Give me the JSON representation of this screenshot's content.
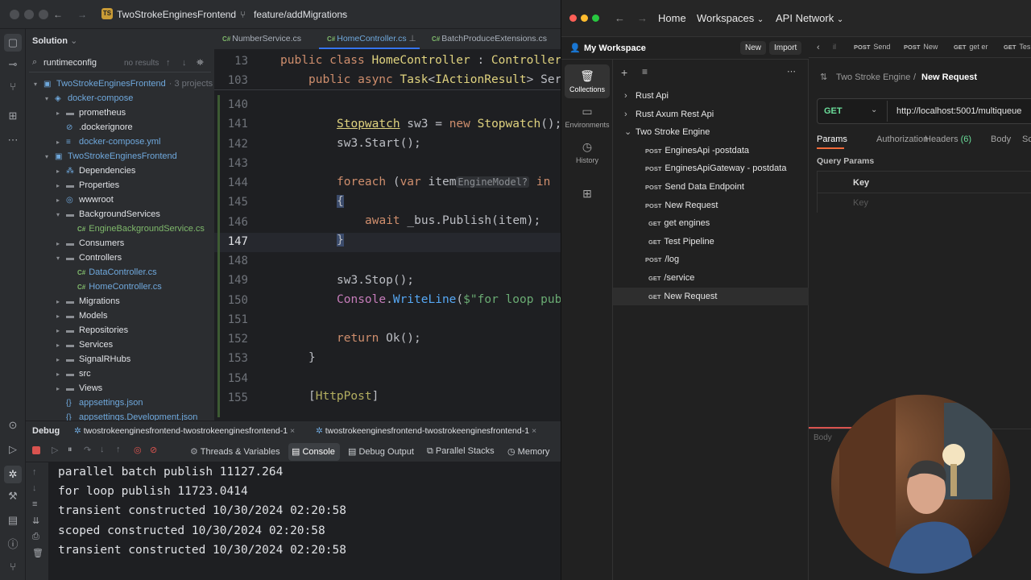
{
  "ide": {
    "project_name": "TwoStrokeEnginesFrontend",
    "project_badge": "TS",
    "branch": "feature/addMigrations",
    "solution_label": "Solution",
    "search_value": "runtimeconfig",
    "search_results": "no results",
    "tree": [
      {
        "label": "TwoStrokeEnginesFrontend",
        "extra": "· 3 projects",
        "depth": 0,
        "arrow": "▾",
        "icon": "solution-icon",
        "color": "blue"
      },
      {
        "label": "docker-compose",
        "depth": 1,
        "arrow": "▾",
        "icon": "docker-icon",
        "color": "blue"
      },
      {
        "label": "prometheus",
        "depth": 2,
        "arrow": "▸",
        "icon": "folder-icon"
      },
      {
        "label": ".dockerignore",
        "depth": 2,
        "arrow": "",
        "icon": "ignore-icon"
      },
      {
        "label": "docker-compose.yml",
        "depth": 2,
        "arrow": "▸",
        "icon": "yml-icon",
        "color": "blue"
      },
      {
        "label": "TwoStrokeEnginesFrontend",
        "depth": 1,
        "arrow": "▾",
        "icon": "project-icon",
        "color": "blue"
      },
      {
        "label": "Dependencies",
        "depth": 2,
        "arrow": "▸",
        "icon": "dependencies-icon"
      },
      {
        "label": "Properties",
        "depth": 2,
        "arrow": "▸",
        "icon": "folder-icon"
      },
      {
        "label": "wwwroot",
        "depth": 2,
        "arrow": "▸",
        "icon": "globe-folder-icon"
      },
      {
        "label": "BackgroundServices",
        "depth": 2,
        "arrow": "▾",
        "icon": "folder-icon"
      },
      {
        "label": "EngineBackgroundService.cs",
        "depth": 3,
        "arrow": "",
        "icon": "csharp-icon",
        "color": "green"
      },
      {
        "label": "Consumers",
        "depth": 2,
        "arrow": "▸",
        "icon": "folder-icon"
      },
      {
        "label": "Controllers",
        "depth": 2,
        "arrow": "▾",
        "icon": "folder-icon"
      },
      {
        "label": "DataController.cs",
        "depth": 3,
        "arrow": "",
        "icon": "csharp-icon",
        "color": "blue"
      },
      {
        "label": "HomeController.cs",
        "depth": 3,
        "arrow": "",
        "icon": "csharp-icon",
        "color": "blue"
      },
      {
        "label": "Migrations",
        "depth": 2,
        "arrow": "▸",
        "icon": "folder-icon"
      },
      {
        "label": "Models",
        "depth": 2,
        "arrow": "▸",
        "icon": "folder-icon"
      },
      {
        "label": "Repositories",
        "depth": 2,
        "arrow": "▸",
        "icon": "folder-icon"
      },
      {
        "label": "Services",
        "depth": 2,
        "arrow": "▸",
        "icon": "folder-icon"
      },
      {
        "label": "SignalRHubs",
        "depth": 2,
        "arrow": "▸",
        "icon": "folder-icon"
      },
      {
        "label": "src",
        "depth": 2,
        "arrow": "▸",
        "icon": "folder-icon"
      },
      {
        "label": "Views",
        "depth": 2,
        "arrow": "▸",
        "icon": "folder-icon"
      },
      {
        "label": "appsettings.json",
        "depth": 2,
        "arrow": "",
        "icon": "json-icon",
        "color": "blue"
      },
      {
        "label": "appsettings.Development.json",
        "depth": 2,
        "arrow": "",
        "icon": "json-icon",
        "color": "blue"
      }
    ],
    "tabs": [
      {
        "label": "NumberService.cs",
        "active": false
      },
      {
        "label": "HomeController.cs",
        "active": true
      },
      {
        "label": "BatchProduceExtensions.cs",
        "active": false
      }
    ],
    "csharp_tag": "C#",
    "sticky_lines": [
      {
        "num": "13"
      },
      {
        "num": "103"
      }
    ],
    "lines": [
      "140",
      "141",
      "142",
      "143",
      "144",
      "145",
      "146",
      "147",
      "148",
      "149",
      "150",
      "151",
      "152",
      "153",
      "154",
      "155"
    ],
    "current_line": "147",
    "debug": {
      "label": "Debug",
      "session1": "twostrokeenginesfrontend-twostrokeenginesfrontend-1",
      "session2": "twostrokeenginesfrontend-twostrokeenginesfrontend-1",
      "tools": [
        "Threads & Variables",
        "Console",
        "Debug Output",
        "Parallel Stacks",
        "Memory"
      ],
      "console_lines": [
        "parallel batch publish 11127.264",
        "for loop publish 11723.0414",
        "transient constructed 10/30/2024 02:20:58",
        "scoped constructed 10/30/2024 02:20:58",
        "transient constructed 10/30/2024 02:20:58"
      ]
    }
  },
  "postman": {
    "nav": {
      "home": "Home",
      "workspaces": "Workspaces",
      "network": "API Network"
    },
    "workspace": "My Workspace",
    "new_btn": "New",
    "import_btn": "Import",
    "rail": [
      "Collections",
      "Environments",
      "History"
    ],
    "collections": [
      {
        "label": "Rust Api",
        "method": "",
        "depth": 0,
        "arrow": "›"
      },
      {
        "label": "Rust Axum Rest Api",
        "method": "",
        "depth": 0,
        "arrow": "›"
      },
      {
        "label": "Two Stroke Engine",
        "method": "",
        "depth": 0,
        "arrow": "⌄"
      },
      {
        "label": "EnginesApi -postdata",
        "method": "POST",
        "depth": 1
      },
      {
        "label": "EnginesApiGateway - postdata",
        "method": "POST",
        "depth": 1
      },
      {
        "label": "Send Data Endpoint",
        "method": "POST",
        "depth": 1
      },
      {
        "label": "New Request",
        "method": "POST",
        "depth": 1
      },
      {
        "label": "get engines",
        "method": "GET",
        "depth": 1
      },
      {
        "label": "Test Pipeline",
        "method": "GET",
        "depth": 1
      },
      {
        "label": "/log",
        "method": "POST",
        "depth": 1
      },
      {
        "label": "/service",
        "method": "GET",
        "depth": 1
      },
      {
        "label": "New Request",
        "method": "GET",
        "depth": 1,
        "selected": true
      }
    ],
    "open_tabs": [
      {
        "m": "POST",
        "t": "Send"
      },
      {
        "m": "POST",
        "t": "New"
      },
      {
        "m": "GET",
        "t": "get er"
      },
      {
        "m": "GET",
        "t": "Tes"
      }
    ],
    "breadcrumb": {
      "parent": "Two Stroke Engine",
      "current": "New Request"
    },
    "method": "GET",
    "url": "http://localhost:5001/multiqueue",
    "subtabs": [
      "Params",
      "Authorization",
      "Headers",
      "Body",
      "Sc"
    ],
    "headers_count": "(6)",
    "query_params_label": "Query Params",
    "key_header": "Key",
    "key_placeholder": "Key",
    "body_label": "Body"
  }
}
